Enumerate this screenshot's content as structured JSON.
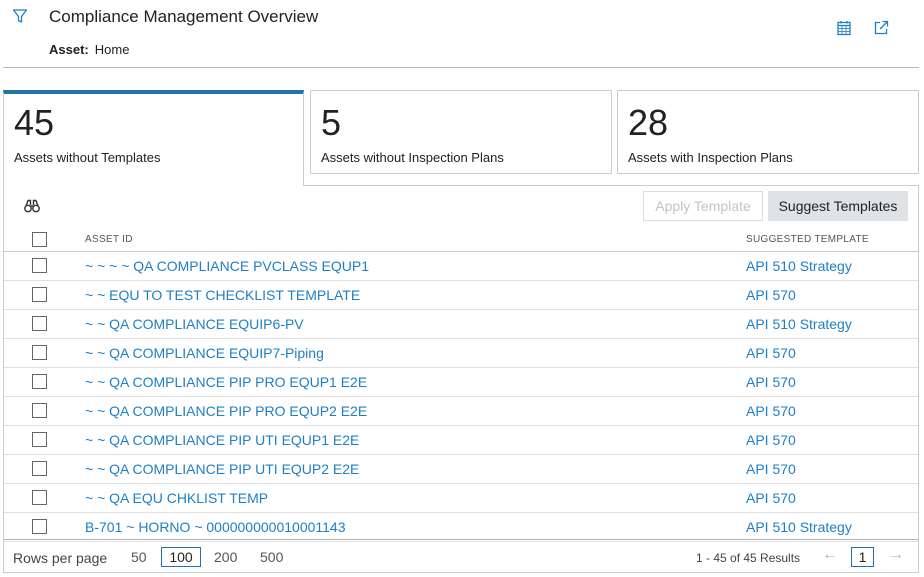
{
  "header": {
    "title": "Compliance Management Overview",
    "asset_label": "Asset:",
    "asset_value": "Home",
    "icons": [
      "filter-icon",
      "calendar-icon",
      "external-link-icon"
    ]
  },
  "tiles": [
    {
      "count": "45",
      "label": "Assets without Templates",
      "active": true
    },
    {
      "count": "5",
      "label": "Assets without Inspection Plans",
      "active": false
    },
    {
      "count": "28",
      "label": "Assets with Inspection Plans",
      "active": false
    }
  ],
  "toolbar": {
    "search_icon": "binoculars-icon",
    "apply_label": "Apply Template",
    "suggest_label": "Suggest Templates"
  },
  "table": {
    "columns": [
      "ASSET ID",
      "SUGGESTED TEMPLATE"
    ],
    "rows": [
      {
        "asset_id": "~ ~ ~ ~ QA COMPLIANCE PVCLASS EQUP1",
        "template": "API 510 Strategy"
      },
      {
        "asset_id": "~ ~ EQU TO TEST CHECKLIST TEMPLATE",
        "template": "API 570"
      },
      {
        "asset_id": "~ ~ QA COMPLIANCE EQUIP6-PV",
        "template": "API 510 Strategy"
      },
      {
        "asset_id": "~ ~ QA COMPLIANCE EQUIP7-Piping",
        "template": "API 570"
      },
      {
        "asset_id": "~ ~ QA COMPLIANCE PIP PRO EQUP1 E2E",
        "template": "API 570"
      },
      {
        "asset_id": "~ ~ QA COMPLIANCE PIP PRO EQUP2 E2E",
        "template": "API 570"
      },
      {
        "asset_id": "~ ~ QA COMPLIANCE PIP UTI EQUP1 E2E",
        "template": "API 570"
      },
      {
        "asset_id": "~ ~ QA COMPLIANCE PIP UTI EQUP2 E2E",
        "template": "API 570"
      },
      {
        "asset_id": "~ ~ QA EQU CHKLIST TEMP",
        "template": "API 570"
      },
      {
        "asset_id": "B-701 ~ HORNO ~ 000000000010001143",
        "template": "API 510 Strategy"
      }
    ]
  },
  "footer": {
    "rows_per_page_label": "Rows per page",
    "options": [
      "50",
      "100",
      "200",
      "500"
    ],
    "selected_option": "100",
    "results_text": "1 - 45 of 45 Results",
    "current_page": "1",
    "prev_icon": "arrow-left-icon",
    "next_icon": "arrow-right-icon"
  },
  "colors": {
    "accent": "#1e76a8",
    "link": "#1f7fc4"
  }
}
